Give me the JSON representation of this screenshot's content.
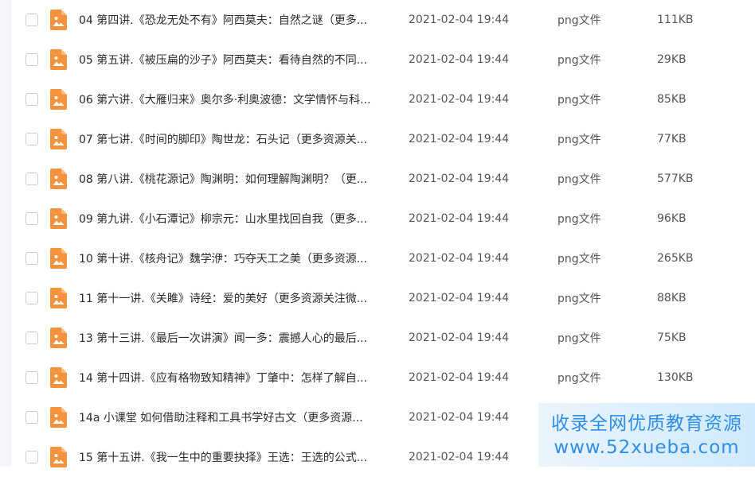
{
  "files": [
    {
      "name": "04 第四讲.《恐龙无处不有》阿西莫夫：自然之谜（更多...",
      "date": "2021-02-04 19:44",
      "type": "png文件",
      "size": "111KB"
    },
    {
      "name": "05 第五讲.《被压扁的沙子》阿西莫夫：看待自然的不同...",
      "date": "2021-02-04 19:44",
      "type": "png文件",
      "size": "29KB"
    },
    {
      "name": "06 第六讲.《大雁归来》奥尔多·利奥波德：文学情怀与科...",
      "date": "2021-02-04 19:44",
      "type": "png文件",
      "size": "85KB"
    },
    {
      "name": "07 第七讲.《时间的脚印》陶世龙：石头记（更多资源关...",
      "date": "2021-02-04 19:44",
      "type": "png文件",
      "size": "77KB"
    },
    {
      "name": "08 第八讲.《桃花源记》陶渊明：如何理解陶渊明？（更...",
      "date": "2021-02-04 19:44",
      "type": "png文件",
      "size": "577KB"
    },
    {
      "name": "09 第九讲.《小石潭记》柳宗元：山水里找回自我（更多...",
      "date": "2021-02-04 19:44",
      "type": "png文件",
      "size": "96KB"
    },
    {
      "name": "10 第十讲.《核舟记》魏学洢：巧夺天工之美（更多资源...",
      "date": "2021-02-04 19:44",
      "type": "png文件",
      "size": "265KB"
    },
    {
      "name": "11 第十一讲.《关雎》诗经：爱的美好（更多资源关注微...",
      "date": "2021-02-04 19:44",
      "type": "png文件",
      "size": "88KB"
    },
    {
      "name": "13 第十三讲.《最后一次讲演》闻一多：震撼人心的最后...",
      "date": "2021-02-04 19:44",
      "type": "png文件",
      "size": "75KB"
    },
    {
      "name": "14 第十四讲.《应有格物致知精神》丁肇中：怎样了解自...",
      "date": "2021-02-04 19:44",
      "type": "png文件",
      "size": "130KB"
    },
    {
      "name": "14a 小课堂 如何借助注释和工具书学好古文（更多资源...",
      "date": "2021-02-04 19:44",
      "type": "",
      "size": ""
    },
    {
      "name": "15 第十五讲.《我一生中的重要抉择》王选：王选的公式...",
      "date": "2021-02-04 19:44",
      "type": "",
      "size": ""
    }
  ],
  "watermark": {
    "line1": "收录全网优质教育资源",
    "line2": "www.52xueba.com"
  },
  "colors": {
    "icon_orange": "#f5923e",
    "watermark_blue": "#2f8ee8"
  },
  "icon": "image-file-icon"
}
